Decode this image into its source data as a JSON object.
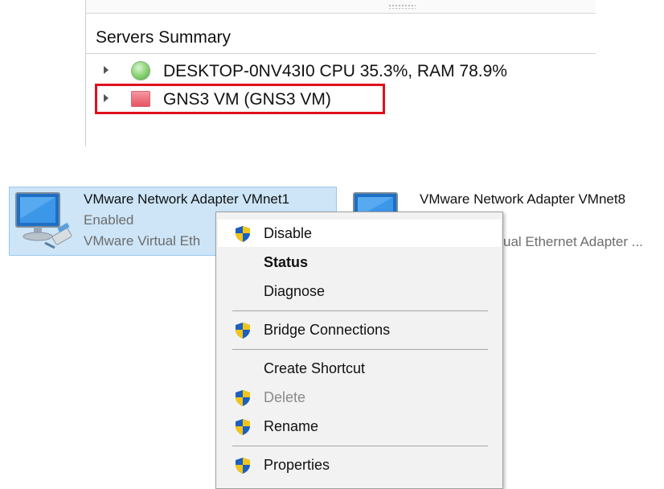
{
  "servers_summary": {
    "title": "Servers Summary",
    "servers": [
      {
        "label": "DESKTOP-0NV43I0 CPU 35.3%, RAM 78.9%",
        "status": "running",
        "status_color": "#5cb84a"
      },
      {
        "label": "GNS3 VM (GNS3 VM)",
        "status": "stopped",
        "status_color": "#e5505f"
      }
    ],
    "highlight_color": "#e0101e"
  },
  "adapters": [
    {
      "name": "VMware Network Adapter VMnet1",
      "status": "Enabled",
      "description": "VMware Virtual Eth"
    },
    {
      "name": "VMware Network Adapter VMnet8",
      "description": "ual Ethernet Adapter ..."
    }
  ],
  "context_menu": {
    "items": [
      {
        "label": "Disable",
        "icon": "uac-shield-icon"
      },
      {
        "label": "Status"
      },
      {
        "label": "Diagnose"
      },
      {
        "label": "Bridge Connections",
        "icon": "uac-shield-icon"
      },
      {
        "label": "Create Shortcut"
      },
      {
        "label": "Delete",
        "icon": "uac-shield-icon",
        "disabled": true
      },
      {
        "label": "Rename",
        "icon": "uac-shield-icon"
      },
      {
        "label": "Properties",
        "icon": "uac-shield-icon"
      }
    ]
  },
  "colors": {
    "selection_bg": "#cde5f7",
    "selection_border": "#99c9ef",
    "menu_bg": "#f2f2f2"
  }
}
